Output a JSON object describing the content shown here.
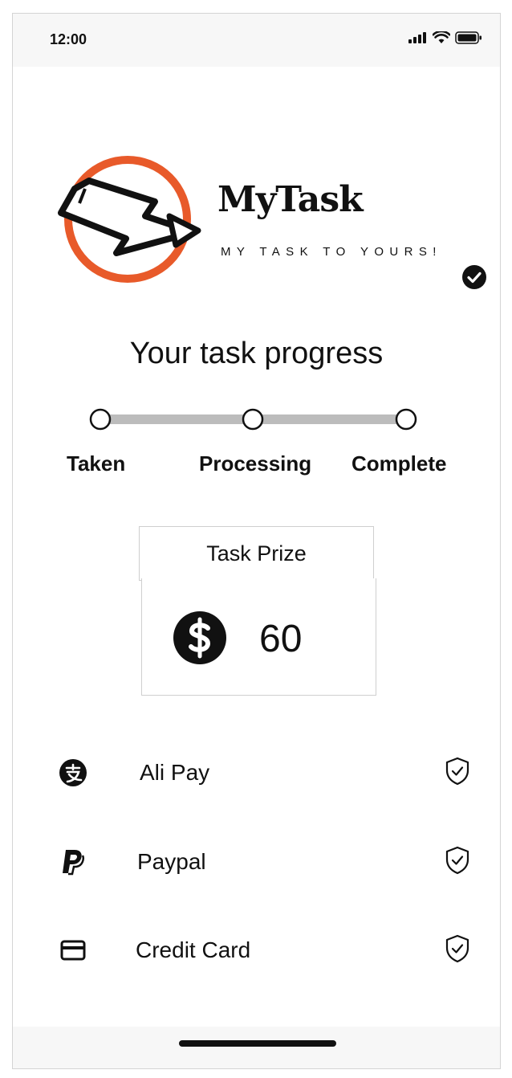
{
  "status_bar": {
    "time": "12:00"
  },
  "brand": {
    "name": "MyTask",
    "tagline": "MY TASK TO YOURS!",
    "accent_color": "#e85a2a"
  },
  "progress": {
    "title": "Your task progress",
    "steps": [
      "Taken",
      "Processing",
      "Complete"
    ]
  },
  "prize": {
    "header": "Task Prize",
    "amount": "60",
    "icon": "dollar-circle-icon"
  },
  "payment_methods": [
    {
      "label": "Ali Pay",
      "icon": "alipay-icon"
    },
    {
      "label": "Paypal",
      "icon": "paypal-icon"
    },
    {
      "label": "Credit Card",
      "icon": "credit-card-icon"
    }
  ]
}
